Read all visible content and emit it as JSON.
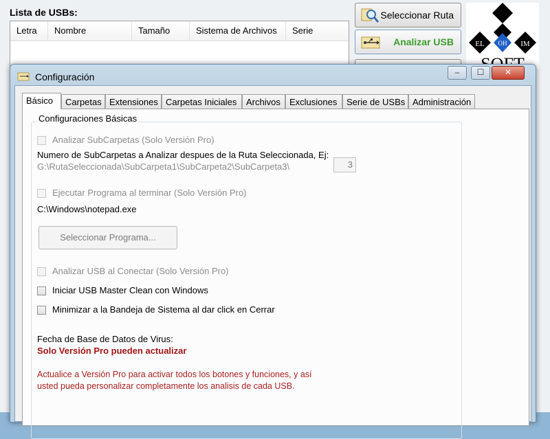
{
  "main": {
    "usb_list_title": "Lista de USBs:",
    "columns": [
      "Letra",
      "Nombre",
      "Tamaño",
      "Sistema de Archivos",
      "Serie"
    ],
    "buttons": {
      "select_path": "Seleccionar Ruta",
      "analyze_usb": "Analizar USB"
    },
    "logo": {
      "top": "EL",
      "middle": "OH",
      "right": "IM",
      "bottom": "SOFT"
    }
  },
  "dialog": {
    "title": "Configuración",
    "controls": {
      "minimize": "–",
      "maximize": "☐",
      "close": "✕"
    },
    "tabs": [
      "Básico",
      "Carpetas",
      "Extensiones",
      "Carpetas Iniciales",
      "Archivos",
      "Exclusiones",
      "Serie de USBs",
      "Administración"
    ],
    "active_tab": "Básico",
    "group_title": "Configuraciones Básicas",
    "analyze_subfolders": "Analizar SubCarpetas (Solo Versión Pro)",
    "subfolders_count_label": "Numero de SubCarpetas a Analizar despues de la Ruta Seleccionada, Ej:",
    "subfolders_example": "G:\\RutaSeleccionada\\SubCarpeta1\\SubCarpeta2\\SubCarpeta3\\",
    "subfolders_depth": "3",
    "run_program": "Ejecutar Programa al terminar (Solo Versión Pro)",
    "program_path": "C:\\Windows\\notepad.exe",
    "select_program_button": "Seleccionar Programa...",
    "analyze_on_connect": "Analizar USB al Conectar (Solo Versión Pro)",
    "start_with_windows": "Iniciar USB Master Clean con Windows",
    "minimize_to_tray": "Minimizar a la Bandeja de Sistema al dar click en Cerrar",
    "virus_db_label": "Fecha de Base de Datos de Virus:",
    "virus_db_value": "Solo Versión Pro pueden actualizar",
    "pro_notice_line1": "Actualice a Versión Pro para activar todos los botones y funciones, y así",
    "pro_notice_line2": "usted pueda personalizar completamente los analisis de cada USB."
  },
  "colors": {
    "analyze_button_text": "#3d9c2d",
    "pro_warning": "#a01515"
  }
}
